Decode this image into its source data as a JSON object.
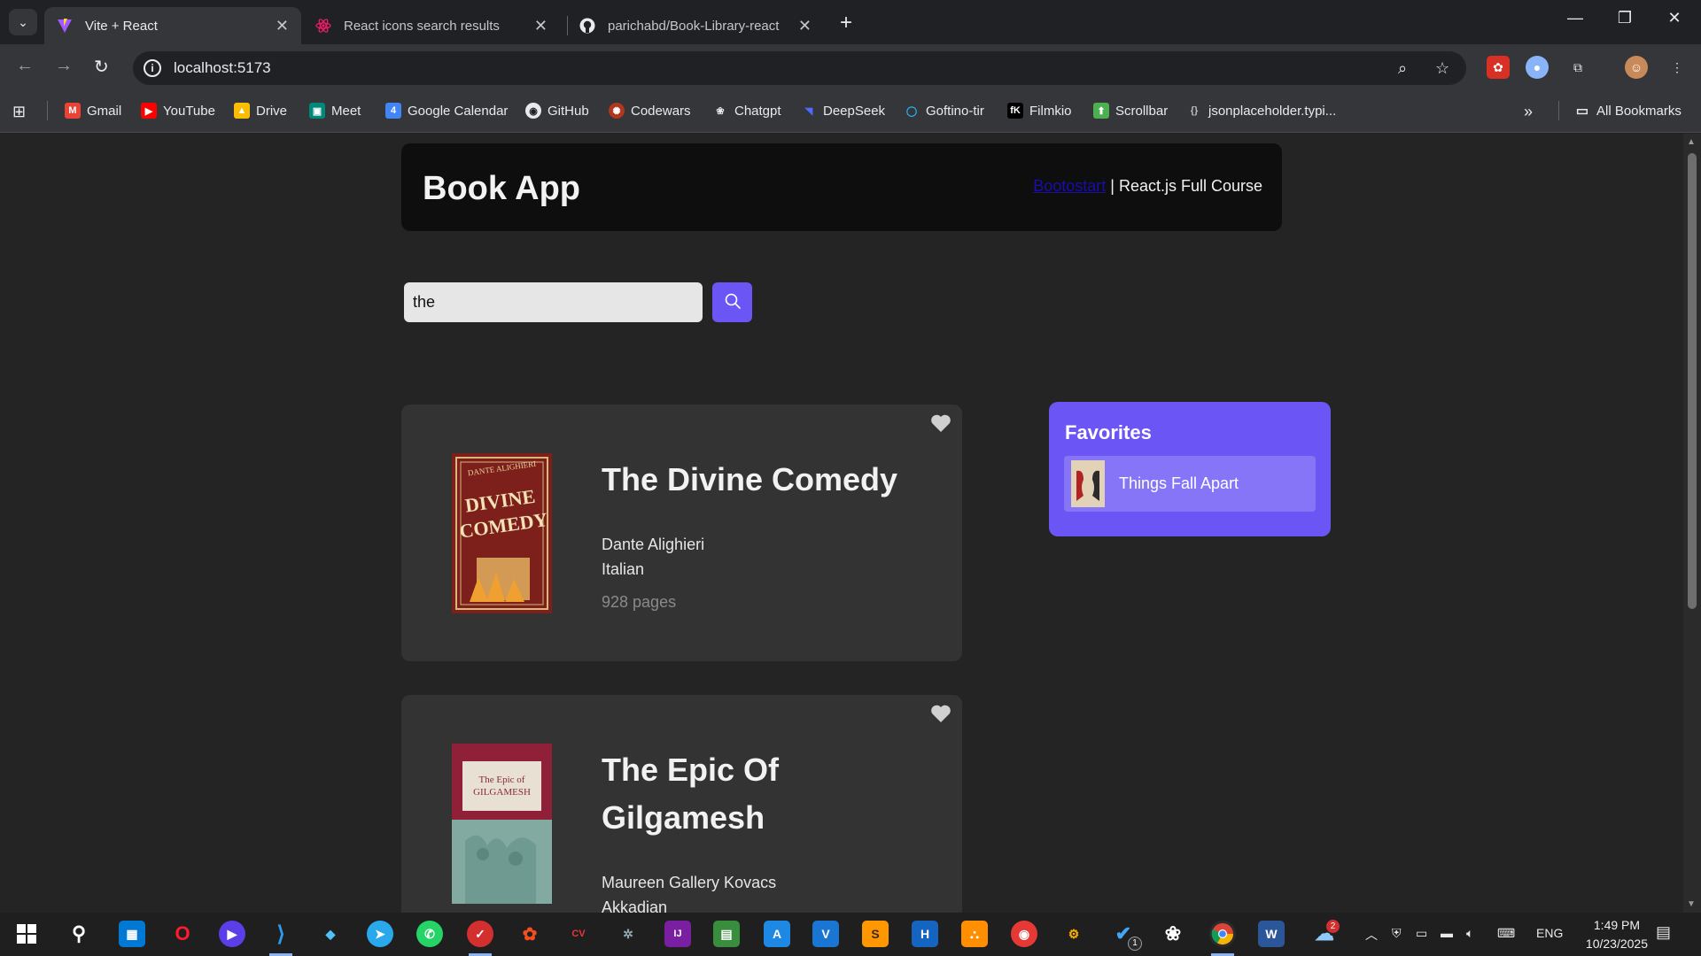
{
  "browser": {
    "tabs": [
      {
        "title": "Vite + React",
        "icon": "vite-icon",
        "active": true
      },
      {
        "title": "React icons search results",
        "icon": "react-icon",
        "active": false
      },
      {
        "title": "parichabd/Book-Library-react",
        "icon": "github-icon",
        "active": false
      }
    ],
    "url": "localhost:5173",
    "bookmarks": [
      {
        "label": "Gmail",
        "icon": "gmail-icon",
        "color": "#ea4335"
      },
      {
        "label": "YouTube",
        "icon": "youtube-icon",
        "color": "#ff0000"
      },
      {
        "label": "Drive",
        "icon": "drive-icon",
        "color": "#fbbc04"
      },
      {
        "label": "Meet",
        "icon": "meet-icon",
        "color": "#00897b"
      },
      {
        "label": "Google Calendar",
        "icon": "calendar-icon",
        "color": "#4285f4"
      },
      {
        "label": "GitHub",
        "icon": "github-icon",
        "color": "#ffffff"
      },
      {
        "label": "Codewars",
        "icon": "codewars-icon",
        "color": "#b1361e"
      },
      {
        "label": "Chatgpt",
        "icon": "chatgpt-icon",
        "color": "#ffffff"
      },
      {
        "label": "DeepSeek",
        "icon": "deepseek-icon",
        "color": "#4d6bfe"
      },
      {
        "label": "Goftino-tir",
        "icon": "goftino-icon",
        "color": "#29b6f6"
      },
      {
        "label": "Filmkio",
        "icon": "filmkio-icon",
        "color": "#000000"
      },
      {
        "label": "Scrollbar",
        "icon": "scrollbar-icon",
        "color": "#4caf50"
      },
      {
        "label": "jsonplaceholder.typi...",
        "icon": "jsonplaceholder-icon",
        "color": "#9e9e9e"
      }
    ],
    "all_bookmarks": "All Bookmarks"
  },
  "app": {
    "title": "Book App",
    "credit_link": "Bootostart",
    "credit_text": " | React.js Full Course",
    "search": {
      "value": "the",
      "placeholder": ""
    },
    "accent": "#6c55f5"
  },
  "books": [
    {
      "title": "The Divine Comedy",
      "author": "Dante Alighieri",
      "language": "Italian",
      "pages": "928 pages",
      "cover_title": "DIVINE COMEDY",
      "cover_author": "DANTE ALIGHIERI"
    },
    {
      "title": "The Epic Of Gilgamesh",
      "author": "Maureen Gallery Kovacs",
      "language": "Akkadian",
      "pages": "",
      "cover_title": "The Epic of GILGAMESH"
    }
  ],
  "favorites": {
    "title": "Favorites",
    "items": [
      {
        "label": "Things Fall Apart"
      }
    ]
  },
  "taskbar": {
    "language": "ENG",
    "time": "1:49 PM",
    "date": "10/23/2025",
    "notification_badge": "2",
    "todo_badge": "1"
  }
}
